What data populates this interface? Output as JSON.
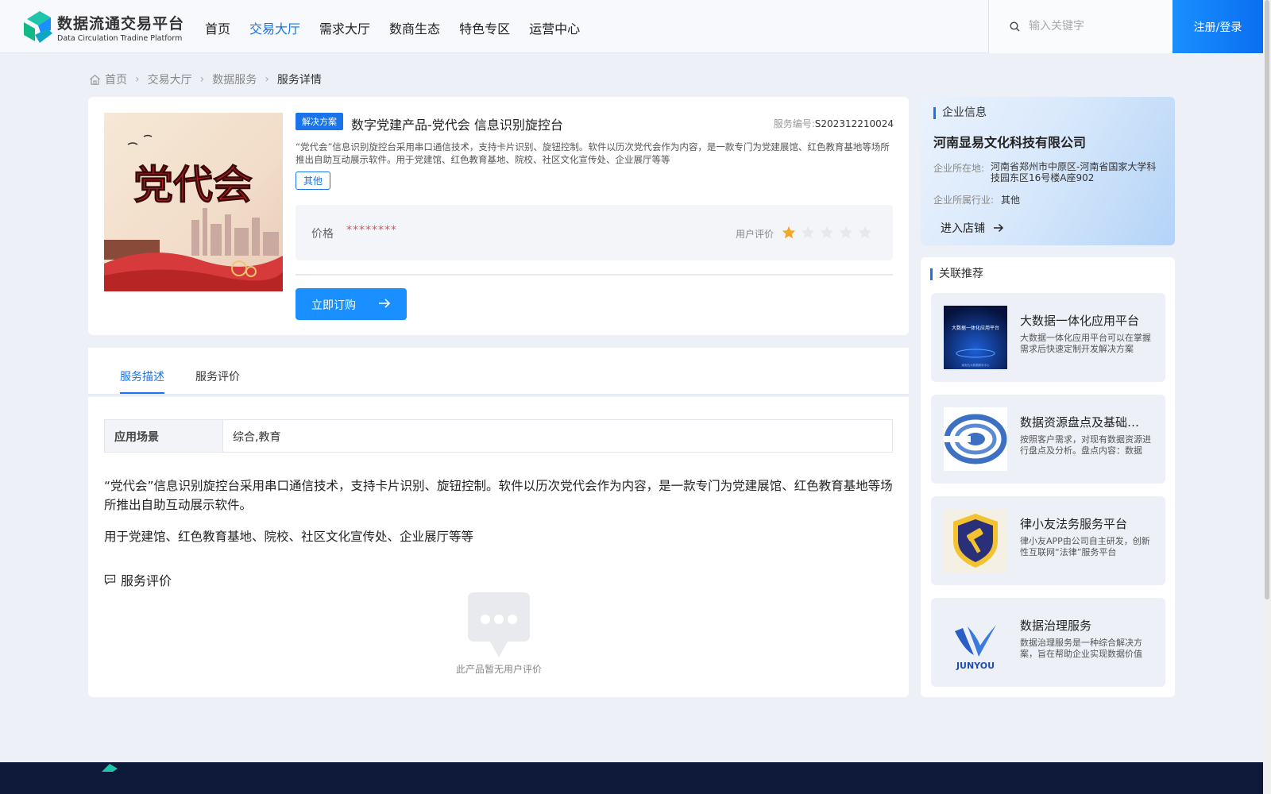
{
  "header": {
    "logo_title": "数据流通交易平台",
    "logo_subtitle": "Data Circulation Tradine Platform",
    "nav": [
      {
        "label": "首页"
      },
      {
        "label": "交易大厅",
        "active": true
      },
      {
        "label": "需求大厅"
      },
      {
        "label": "数商生态"
      },
      {
        "label": "特色专区"
      },
      {
        "label": "运营中心"
      }
    ],
    "search_placeholder": "输入关键字",
    "login_label": "注册/登录"
  },
  "breadcrumb": [
    "首页",
    "交易大厅",
    "数据服务",
    "服务详情"
  ],
  "product": {
    "image_text": "党代会",
    "tag": "解决方案",
    "title": "数字党建产品-党代会 信息识别旋控台",
    "service_no_label": "服务编号:",
    "service_no": "S202312210024",
    "description": "“党代会”信息识别旋控台采用串口通信技术，支持卡片识别、旋钮控制。软件以历次党代会作为内容，是一款专门为党建展馆、红色教育基地等场所推出自助互动展示软件。用于党建馆、红色教育基地、院校、社区文化宣传处、企业展厅等等",
    "category_tag": "其他",
    "price_label": "价格",
    "price_value": "********",
    "rating_label": "用户评价",
    "rating": 1,
    "rating_max": 5,
    "buy_label": "立即订购"
  },
  "tabs": [
    {
      "label": "服务描述",
      "active": true
    },
    {
      "label": "服务评价"
    }
  ],
  "detail": {
    "scene_label": "应用场景",
    "scene_value": "综合,教育",
    "paragraph1": "“党代会”信息识别旋控台采用串口通信技术，支持卡片识别、旋钮控制。软件以历次党代会作为内容，是一款专门为党建展馆、红色教育基地等场所推出自助互动展示软件。",
    "paragraph2": "用于党建馆、红色教育基地、院校、社区文化宣传处、企业展厅等等",
    "review_heading": "服务评价",
    "empty_text": "此产品暂无用户评价"
  },
  "company": {
    "heading": "企业信息",
    "name": "河南显易文化科技有限公司",
    "location_label": "企业所在地:",
    "location": "河南省郑州市中原区-河南省国家大学科技园东区16号楼A座902",
    "industry_label": "企业所属行业:",
    "industry": "其他",
    "store_label": "进入店铺"
  },
  "recommend": {
    "heading": "关联推荐",
    "items": [
      {
        "title": "大数据一体化应用平台",
        "desc": "大数据一体化应用平台可以在掌握需求后快速定制开发解决方案",
        "thumb_text": "大数据一体化应用平台",
        "thumb_caption": "南安兆大数据服务中心"
      },
      {
        "title": "数据资源盘点及基础梳理服务",
        "desc": "按照客户需求，对现有数据资源进行盘点及分析。盘点内容：数据"
      },
      {
        "title": "律小友法务服务平台",
        "desc": "律小友APP由公司自主研发，创新性互联网“法律”服务平台"
      },
      {
        "title": "数据治理服务",
        "desc": "数据治理服务是一种综合解决方案，旨在帮助企业实现数据价值",
        "thumb_text": "JUNYOU"
      }
    ]
  },
  "colors": {
    "accent": "#1a73e8",
    "price": "#e94e4e",
    "star": "#f5a623",
    "footer": "#0f1a3a"
  }
}
